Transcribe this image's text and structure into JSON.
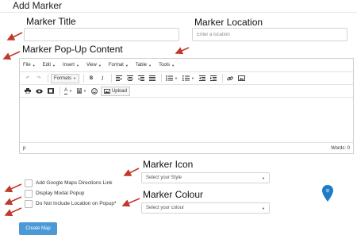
{
  "page_title": "Add Marker",
  "labels": {
    "marker_title": "Marker Title",
    "marker_location": "Marker Location",
    "popup_content": "Marker Pop-Up Content",
    "marker_icon": "Marker Icon",
    "marker_colour": "Marker Colour"
  },
  "location_input": {
    "placeholder": "Enter a location",
    "value": ""
  },
  "title_input": {
    "placeholder": "",
    "value": ""
  },
  "editor": {
    "menu": [
      "File",
      "Edit",
      "Insert",
      "View",
      "Format",
      "Table",
      "Tools"
    ],
    "toolbar": {
      "formats_label": "Formats",
      "upload_label": "Upload",
      "bold": "B",
      "italic": "I",
      "font_color": "A",
      "bg_color": "A"
    },
    "status": {
      "path": "p",
      "words": "Words: 0"
    }
  },
  "checkboxes": [
    {
      "label": "Add Google Maps Directions Link",
      "checked": false
    },
    {
      "label": "Display Modal Popup",
      "checked": false
    },
    {
      "label": "Do Not Include Location on Popup*",
      "checked": false
    }
  ],
  "icon_select": {
    "value": "Select your Style"
  },
  "colour_select": {
    "value": "Select your colour"
  },
  "submit_button": {
    "label": "Create Map"
  },
  "colors": {
    "accent": "#4b9ad6",
    "arrow": "#c0392b",
    "marker_pin": "#1e7bc6"
  },
  "icons": [
    "undo-icon",
    "redo-icon",
    "print-icon",
    "preview-icon",
    "media-icon",
    "emoticon-icon",
    "map-pin-icon"
  ]
}
